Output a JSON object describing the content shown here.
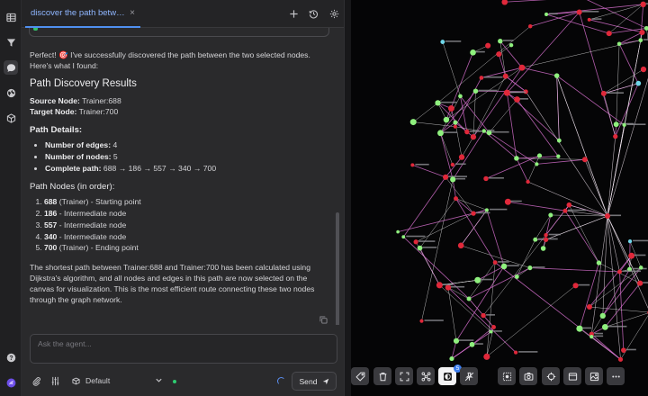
{
  "rail": {
    "items": [
      {
        "icon": "table-icon"
      },
      {
        "icon": "filter-icon"
      },
      {
        "icon": "chat-icon",
        "active": true
      },
      {
        "icon": "globe-icon"
      },
      {
        "icon": "cube-icon"
      }
    ],
    "help_icon": "help-icon",
    "logo_icon": "app-logo-icon"
  },
  "tab": {
    "title": "discover the path betwee…",
    "close": "×"
  },
  "message": {
    "intro_a": "Perfect! ",
    "intro_emoji": "🎯",
    "intro_b": " I've successfully discovered the path between the two selected nodes. Here's what I found:",
    "heading": "Path Discovery Results",
    "source_label": "Source Node:",
    "source_value": " Trainer:688",
    "target_label": "Target Node:",
    "target_value": " Trainer:700",
    "details_heading": "Path Details:",
    "details": [
      {
        "label": "Number of edges:",
        "value": " 4"
      },
      {
        "label": "Number of nodes:",
        "value": " 5"
      },
      {
        "label": "Complete path:",
        "value": " 688 → 186 → 557 → 340 → 700"
      }
    ],
    "nodes_heading": "Path Nodes (in order):",
    "nodes": [
      {
        "id": "688",
        "desc": " (Trainer) - Starting point"
      },
      {
        "id": "186",
        "desc": " - Intermediate node"
      },
      {
        "id": "557",
        "desc": " - Intermediate node"
      },
      {
        "id": "340",
        "desc": " - Intermediate node"
      },
      {
        "id": "700",
        "desc": " (Trainer) - Ending point"
      }
    ],
    "summary": "The shortest path between Trainer:688 and Trainer:700 has been calculated using Dijkstra's algorithm, and all nodes and edges in this path are now selected on the canvas for visualization. This is the most efficient route connecting these two nodes through the graph network."
  },
  "composer": {
    "placeholder": "Ask the agent...",
    "model": "Default",
    "send_label": "Send"
  },
  "toolbar": {
    "badge": "5",
    "tools": [
      "tag-icon",
      "trash-icon",
      "expand-icon",
      "graph-layout-icon",
      "contrast-icon",
      "pin-off-icon",
      "select-icon",
      "camera-icon",
      "crosshair-icon",
      "frame-icon",
      "image-icon",
      "more-icon"
    ]
  },
  "colors": {
    "accent": "#4f8ff0",
    "node_red": "#e0283a",
    "node_green": "#8ff07e",
    "node_teal": "#6fd6e8",
    "edge_pink": "#d06cc8",
    "edge_white": "#f2e6f0"
  }
}
